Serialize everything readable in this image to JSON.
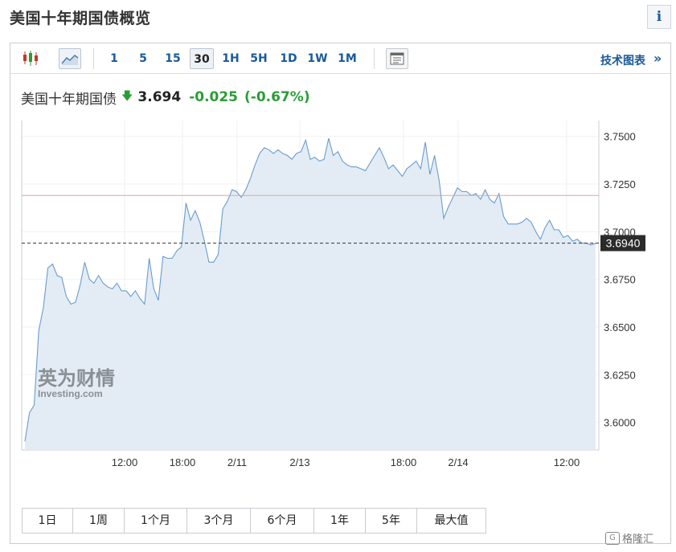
{
  "page": {
    "title": "美国十年期国债概览",
    "info_label": "i"
  },
  "toolbar": {
    "intervals": [
      "1",
      "5",
      "15",
      "30",
      "1H",
      "5H",
      "1D",
      "1W",
      "1M"
    ],
    "active_interval": "30",
    "tech_chart_label": "技术图表",
    "tech_chart_chevron": "»"
  },
  "quote": {
    "name": "美国十年期国债",
    "direction_arrow": "🡇",
    "price": "3.694",
    "change": "-0.025",
    "change_pct": "(-0.67%)"
  },
  "chart_data": {
    "type": "area",
    "title": "",
    "xlabel": "",
    "ylabel": "",
    "ylim": [
      3.5855,
      3.7583
    ],
    "y_ticks": [
      "3.7500",
      "3.7250",
      "3.7000",
      "3.6750",
      "3.6500",
      "3.6250",
      "3.6000"
    ],
    "x_ticks": [
      "12:00",
      "18:00",
      "2/11",
      "2/13",
      "18:00",
      "2/14",
      "12:00"
    ],
    "current_value_label": "3.6940",
    "current_value": 3.694,
    "reference_line": 3.719,
    "grid": true,
    "line_color": "#6a9ccb",
    "fill_color": "#e3ecf5",
    "reference_color": "#e8a0a0",
    "watermark": {
      "cn": "英为财情",
      "en": "Investing.com"
    },
    "series": [
      {
        "values": [
          3.59,
          3.605,
          3.609,
          3.648,
          3.66,
          3.681,
          3.683,
          3.677,
          3.676,
          3.666,
          3.662,
          3.663,
          3.672,
          3.684,
          3.675,
          3.673,
          3.677,
          3.673,
          3.671,
          3.67,
          3.673,
          3.669,
          3.669,
          3.666,
          3.669,
          3.665,
          3.662,
          3.686,
          3.67,
          3.664,
          3.687,
          3.686,
          3.686,
          3.69,
          3.692,
          3.715,
          3.706,
          3.711,
          3.705,
          3.695,
          3.684,
          3.684,
          3.688,
          3.712,
          3.716,
          3.722,
          3.721,
          3.718,
          3.722,
          3.728,
          3.735,
          3.741,
          3.744,
          3.743,
          3.741,
          3.743,
          3.741,
          3.74,
          3.738,
          3.741,
          3.742,
          3.748,
          3.738,
          3.739,
          3.737,
          3.738,
          3.749,
          3.74,
          3.742,
          3.737,
          3.735,
          3.734,
          3.734,
          3.733,
          3.732,
          3.736,
          3.74,
          3.744,
          3.739,
          3.733,
          3.735,
          3.732,
          3.729,
          3.733,
          3.735,
          3.737,
          3.733,
          3.747,
          3.73,
          3.74,
          3.727,
          3.707,
          3.713,
          3.718,
          3.723,
          3.721,
          3.721,
          3.719,
          3.72,
          3.717,
          3.722,
          3.717,
          3.715,
          3.72,
          3.708,
          3.704,
          3.704,
          3.704,
          3.705,
          3.707,
          3.705,
          3.7,
          3.696,
          3.702,
          3.706,
          3.701,
          3.701,
          3.697,
          3.698,
          3.695,
          3.696,
          3.694,
          3.694,
          3.693,
          3.694
        ]
      }
    ]
  },
  "range_buttons": [
    "1日",
    "1周",
    "1个月",
    "3个月",
    "6个月",
    "1年",
    "5年",
    "最大值"
  ],
  "site_watermark": {
    "icon": "G",
    "text": "格隆汇"
  }
}
